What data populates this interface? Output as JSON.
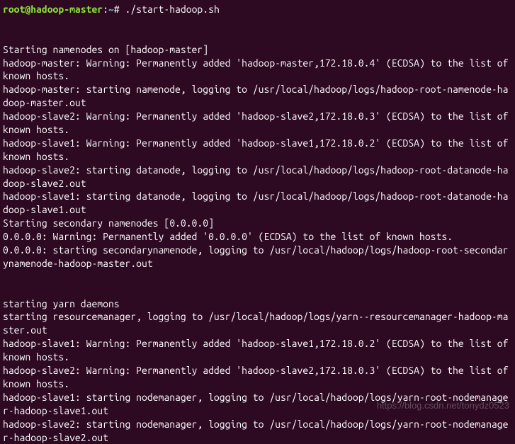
{
  "prompt": {
    "user_host": "root@hadoop-master",
    "separator": ":",
    "path": "~",
    "symbol": "#",
    "command": "./start-hadoop.sh"
  },
  "output": {
    "blank1": "",
    "blank2": "",
    "line1": "Starting namenodes on [hadoop-master]",
    "line2": "hadoop-master: Warning: Permanently added 'hadoop-master,172.18.0.4' (ECDSA) to the list of known hosts.",
    "line3": "hadoop-master: starting namenode, logging to /usr/local/hadoop/logs/hadoop-root-namenode-hadoop-master.out",
    "line4": "hadoop-slave2: Warning: Permanently added 'hadoop-slave2,172.18.0.3' (ECDSA) to the list of known hosts.",
    "line5": "hadoop-slave1: Warning: Permanently added 'hadoop-slave1,172.18.0.2' (ECDSA) to the list of known hosts.",
    "line6": "hadoop-slave2: starting datanode, logging to /usr/local/hadoop/logs/hadoop-root-datanode-hadoop-slave2.out",
    "line7": "hadoop-slave1: starting datanode, logging to /usr/local/hadoop/logs/hadoop-root-datanode-hadoop-slave1.out",
    "line8": "Starting secondary namenodes [0.0.0.0]",
    "line9": "0.0.0.0: Warning: Permanently added '0.0.0.0' (ECDSA) to the list of known hosts.",
    "line10": "0.0.0.0: starting secondarynamenode, logging to /usr/local/hadoop/logs/hadoop-root-secondarynamenode-hadoop-master.out",
    "blank3": "",
    "blank4": "",
    "line11": "starting yarn daemons",
    "line12": "starting resourcemanager, logging to /usr/local/hadoop/logs/yarn--resourcemanager-hadoop-master.out",
    "line13": "hadoop-slave1: Warning: Permanently added 'hadoop-slave1,172.18.0.2' (ECDSA) to the list of known hosts.",
    "line14": "hadoop-slave2: Warning: Permanently added 'hadoop-slave2,172.18.0.3' (ECDSA) to the list of known hosts.",
    "line15": "hadoop-slave1: starting nodemanager, logging to /usr/local/hadoop/logs/yarn-root-nodemanager-hadoop-slave1.out",
    "line16": "hadoop-slave2: starting nodemanager, logging to /usr/local/hadoop/logs/yarn-root-nodemanager-hadoop-slave2.out"
  },
  "watermark": "https://blog.csdn.net/tonydz0523"
}
